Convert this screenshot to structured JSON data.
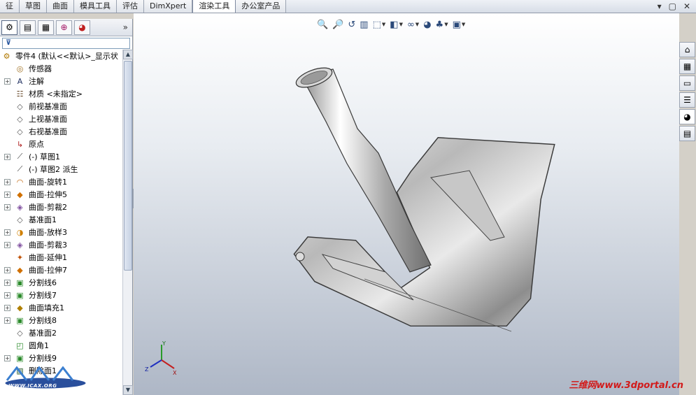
{
  "tabs": [
    "征",
    "草图",
    "曲面",
    "模具工具",
    "评估",
    "DimXpert",
    "渲染工具",
    "办公室产品"
  ],
  "active_tab": "渲染工具",
  "window_controls": [
    "▾",
    "▢",
    "✕"
  ],
  "panel_more": "»",
  "filter_icon": "filter-icon",
  "tree": [
    {
      "label": "零件4   (默认<<默认>_显示状",
      "icon": "part-icon",
      "expand": "",
      "root": true
    },
    {
      "label": "传感器",
      "icon": "sensor-icon",
      "expand": ""
    },
    {
      "label": "注解",
      "icon": "annotation-icon",
      "expand": "+"
    },
    {
      "label": "材质 <未指定>",
      "icon": "material-icon",
      "expand": ""
    },
    {
      "label": "前视基准面",
      "icon": "plane-icon",
      "expand": ""
    },
    {
      "label": "上视基准面",
      "icon": "plane-icon",
      "expand": ""
    },
    {
      "label": "右视基准面",
      "icon": "plane-icon",
      "expand": ""
    },
    {
      "label": "原点",
      "icon": "origin-icon",
      "expand": ""
    },
    {
      "label": "(-) 草图1",
      "icon": "sketch-icon",
      "expand": "+"
    },
    {
      "label": "(-) 草图2 派生",
      "icon": "sketch-icon",
      "expand": ""
    },
    {
      "label": "曲面-旋转1",
      "icon": "surface-revolve-icon",
      "expand": "+"
    },
    {
      "label": "曲面-拉伸5",
      "icon": "surface-extrude-icon",
      "expand": "+"
    },
    {
      "label": "曲面-剪裁2",
      "icon": "surface-trim-icon",
      "expand": "+"
    },
    {
      "label": "基准面1",
      "icon": "plane-icon",
      "expand": ""
    },
    {
      "label": "曲面-放样3",
      "icon": "surface-loft-icon",
      "expand": "+"
    },
    {
      "label": "曲面-剪裁3",
      "icon": "surface-trim-icon",
      "expand": "+"
    },
    {
      "label": "曲面-延伸1",
      "icon": "surface-extend-icon",
      "expand": ""
    },
    {
      "label": "曲面-拉伸7",
      "icon": "surface-extrude-icon",
      "expand": "+"
    },
    {
      "label": "分割线6",
      "icon": "split-line-icon",
      "expand": "+"
    },
    {
      "label": "分割线7",
      "icon": "split-line-icon",
      "expand": "+"
    },
    {
      "label": "曲面填充1",
      "icon": "surface-fill-icon",
      "expand": "+"
    },
    {
      "label": "分割线8",
      "icon": "split-line-icon",
      "expand": "+"
    },
    {
      "label": "基准面2",
      "icon": "plane-icon",
      "expand": ""
    },
    {
      "label": "圆角1",
      "icon": "fillet-icon",
      "expand": ""
    },
    {
      "label": "分割线9",
      "icon": "split-line-icon",
      "expand": "+"
    },
    {
      "label": "删除面1",
      "icon": "delete-face-icon",
      "expand": ""
    }
  ],
  "view_toolbar": [
    {
      "name": "zoom-to-fit-icon",
      "glyph": "🔍",
      "dropdown": false
    },
    {
      "name": "zoom-area-icon",
      "glyph": "🔎",
      "dropdown": false
    },
    {
      "name": "previous-view-icon",
      "glyph": "↺",
      "dropdown": false
    },
    {
      "name": "section-view-icon",
      "glyph": "▥",
      "dropdown": false
    },
    {
      "name": "view-orientation-icon",
      "glyph": "⬚",
      "dropdown": true
    },
    {
      "name": "display-style-icon",
      "glyph": "◧",
      "dropdown": true
    },
    {
      "name": "hide-show-items-icon",
      "glyph": "∞",
      "dropdown": true
    },
    {
      "name": "edit-appearance-icon",
      "glyph": "◕",
      "dropdown": false
    },
    {
      "name": "apply-scene-icon",
      "glyph": "♣",
      "dropdown": true
    },
    {
      "name": "view-settings-icon",
      "glyph": "▣",
      "dropdown": true
    }
  ],
  "taskpane": [
    {
      "name": "home-icon",
      "glyph": "⌂"
    },
    {
      "name": "design-library-icon",
      "glyph": "▦"
    },
    {
      "name": "file-explorer-icon",
      "glyph": "▭"
    },
    {
      "name": "view-palette-icon",
      "glyph": "☰"
    },
    {
      "name": "appearances-icon",
      "glyph": "◕"
    },
    {
      "name": "custom-properties-icon",
      "glyph": "▤"
    }
  ],
  "triad": {
    "x": "X",
    "y": "Y",
    "z": "Z"
  },
  "watermark_left": "WWW.ICAX.ORG",
  "watermark_right": "三维网www.3dportal.cn",
  "colors": {
    "accent": "#2b4a7a",
    "viewport_top": "#ffffff",
    "viewport_bottom": "#aeb7c6"
  }
}
